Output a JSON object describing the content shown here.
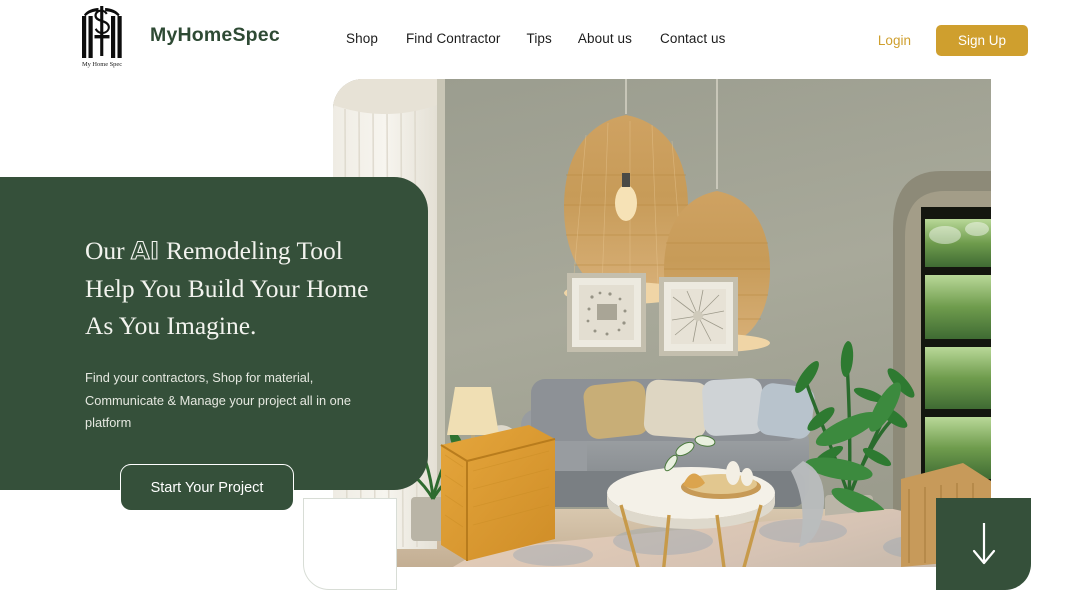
{
  "header": {
    "brand_name": "MyHomeSpec",
    "logo_caption": "My Home Spec",
    "nav": [
      {
        "label": "Shop"
      },
      {
        "label": "Find Contractor"
      },
      {
        "label": "Tips"
      },
      {
        "label": "About us"
      },
      {
        "label": "Contact us"
      }
    ],
    "login_label": "Login",
    "signup_label": "Sign Up"
  },
  "hero": {
    "headline_line1_pre": "Our ",
    "headline_ai": "AI",
    "headline_line1_post": " Remodeling Tool",
    "headline_line2": "Help You Build Your Home",
    "headline_line3": "As You Imagine.",
    "subtext": "Find your contractors, Shop for material, Communicate & Manage your project all in one platform",
    "cta_label": "Start Your Project",
    "image_alt": "living-room-interior-with-rattan-pendant-lamps-gray-sofa-orange-ottoman-and-arched-window"
  },
  "scroll_indicator": {
    "icon": "arrow-down-icon"
  },
  "colors": {
    "brand_green": "#35503a",
    "accent_gold": "#cf9f2e",
    "text_dark": "#1c1c1c",
    "panel_text": "#f2f3ee",
    "page_background": "#ffffff"
  }
}
